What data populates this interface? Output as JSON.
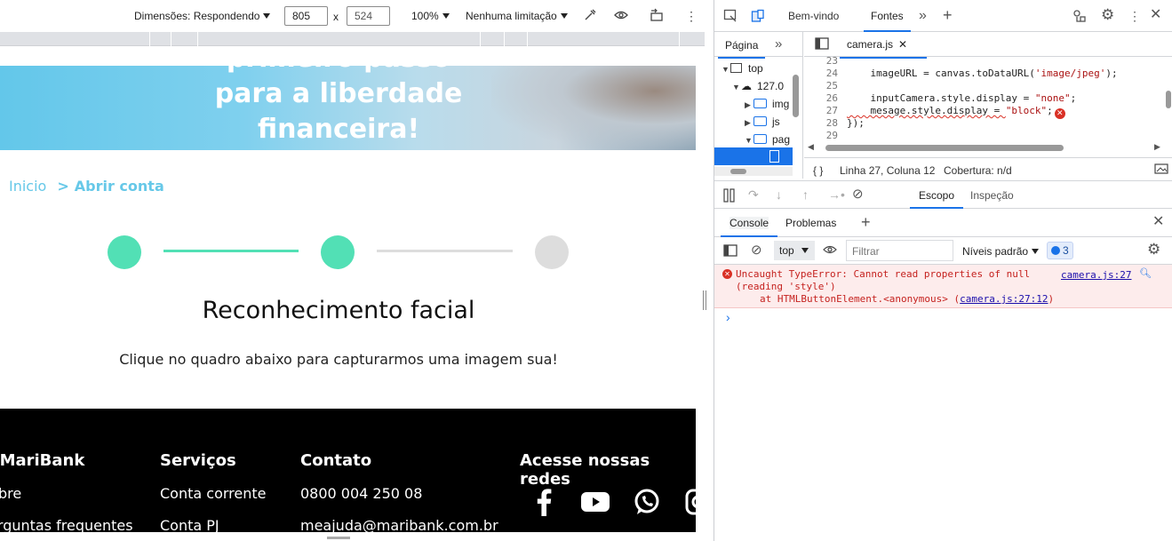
{
  "device_toolbar": {
    "dimensions_label": "Dimensões: Respondendo",
    "width_value": "805",
    "times": "x",
    "height_value": "524",
    "zoom": "100%",
    "throttle": "Nenhuma limitação",
    "icons": [
      "eyedropper-icon",
      "eye-icon",
      "rotate-icon",
      "more-icon"
    ]
  },
  "page": {
    "hero_lines": [
      "primeiro passo",
      "para a liberdade",
      "financeira!"
    ],
    "breadcrumb": {
      "home": "Inicio",
      "separator": ">",
      "current": "Abrir conta"
    },
    "steps_colors": {
      "done": "#52e0b5",
      "pending": "#dddddd",
      "line_done": "#52e0b5",
      "line_pending": "#dddddd"
    },
    "title": "Reconhecimento facial",
    "subtitle": "Clique no quadro abaixo para capturarmos uma imagem sua!",
    "footer": {
      "col1": {
        "heading": "O MariBank",
        "items": [
          "Sobre",
          "Perguntas frequentes"
        ]
      },
      "col2": {
        "heading": "Serviços",
        "items": [
          "Conta corrente",
          "Conta PJ"
        ]
      },
      "col3": {
        "heading": "Contato",
        "items": [
          "0800 004 250 08",
          "meajuda@maribank.com.br"
        ]
      },
      "col4": {
        "heading": "Acesse nossas redes"
      },
      "social_icons": [
        "facebook-icon",
        "youtube-icon",
        "whatsapp-icon",
        "instagram-icon"
      ]
    }
  },
  "devtools": {
    "tabs": [
      "Bem-vindo",
      "Fontes"
    ],
    "active_tab": "Fontes",
    "navigator_tab": "Página",
    "tree": [
      "top",
      "127.0",
      "img",
      "js",
      "pag"
    ],
    "file_tab": "camera.js",
    "code_lines": [
      {
        "n": "23",
        "code": ""
      },
      {
        "n": "24",
        "code": "    imageURL = canvas.toDataURL(",
        "str": "'image/jpeg'",
        "tail": ");"
      },
      {
        "n": "25",
        "code": ""
      },
      {
        "n": "26",
        "code": "    inputCamera.style.display = ",
        "str": "\"none\"",
        "tail": ";"
      },
      {
        "n": "27",
        "code": "    mesage.style.display = ",
        "str": "\"block\"",
        "tail": ";"
      },
      {
        "n": "28",
        "code": "});"
      },
      {
        "n": "29",
        "code": ""
      }
    ],
    "status": {
      "braces": "{ }",
      "position": "Linha 27, Coluna 12",
      "coverage": "Cobertura: n/d"
    },
    "debug_tabs": [
      "Escopo",
      "Inspeção"
    ],
    "drawer_tabs": [
      "Console",
      "Problemas"
    ],
    "console": {
      "context": "top",
      "filter_placeholder": "Filtrar",
      "levels": "Níveis padrão",
      "issues_count": "3",
      "error_line1": "Uncaught TypeError: Cannot read properties of null",
      "error_line2": "(reading 'style')",
      "error_line3_prefix": "at HTMLButtonElement.<anonymous> (",
      "error_line3_link": "camera.js:27:12",
      "error_line3_suffix": ")",
      "error_source": "camera.js:27",
      "prompt": "›"
    }
  }
}
